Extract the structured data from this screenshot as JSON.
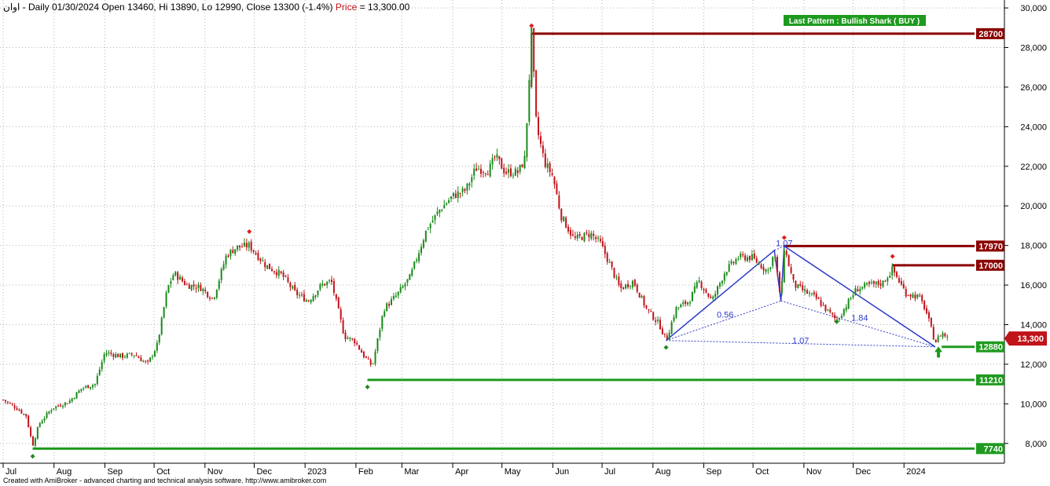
{
  "header": {
    "symbol": "اوان",
    "ohlc_text": " - Daily 01/30/2024 Open 13460, Hi 13890, Lo 12990, Close 13300 (-1.4%)",
    "price_label": " Price",
    "price_value": " = 13,300.00"
  },
  "pattern_label": "Last Pattern : Bullish Shark ( BUY )",
  "footer": "Created with AmiBroker - advanced charting and technical analysis software. http://www.amibroker.com",
  "colors": {
    "up": "#1a8a1a",
    "down": "#c0131a",
    "resistance": "#8b0000",
    "support": "#1e9a1e",
    "pattern": "#2e3cc8"
  },
  "chart_data": {
    "type": "candlestick",
    "ylim": [
      7000,
      30400
    ],
    "x_range_days": [
      0,
      592
    ],
    "y_ticks": [
      {
        "value": 8000,
        "label": "8,000"
      },
      {
        "value": 10000,
        "label": "10,000"
      },
      {
        "value": 12000,
        "label": "12,000"
      },
      {
        "value": 14000,
        "label": "14,000"
      },
      {
        "value": 16000,
        "label": "16,000"
      },
      {
        "value": 18000,
        "label": "18,000"
      },
      {
        "value": 20000,
        "label": "20,000"
      },
      {
        "value": 22000,
        "label": "22,000"
      },
      {
        "value": 24000,
        "label": "24,000"
      },
      {
        "value": 26000,
        "label": "26,000"
      },
      {
        "value": 28000,
        "label": "28,000"
      },
      {
        "value": 30000,
        "label": "30,000"
      }
    ],
    "x_ticks": [
      {
        "day": 0,
        "label": "Jul"
      },
      {
        "day": 31,
        "label": "Aug"
      },
      {
        "day": 62,
        "label": "Sep"
      },
      {
        "day": 92,
        "label": "Oct"
      },
      {
        "day": 123,
        "label": "Nov"
      },
      {
        "day": 153,
        "label": "Dec"
      },
      {
        "day": 184,
        "label": "2023"
      },
      {
        "day": 215,
        "label": "Feb"
      },
      {
        "day": 243,
        "label": "Mar"
      },
      {
        "day": 274,
        "label": "Apr"
      },
      {
        "day": 304,
        "label": "May"
      },
      {
        "day": 335,
        "label": "Jun"
      },
      {
        "day": 365,
        "label": "Jul"
      },
      {
        "day": 396,
        "label": "Aug"
      },
      {
        "day": 427,
        "label": "Sep"
      },
      {
        "day": 457,
        "label": "Oct"
      },
      {
        "day": 488,
        "label": "Nov"
      },
      {
        "day": 518,
        "label": "Dec"
      },
      {
        "day": 549,
        "label": "2024"
      }
    ],
    "anchors": [
      [
        0,
        10200
      ],
      [
        8,
        9800
      ],
      [
        14,
        9400
      ],
      [
        18,
        7900
      ],
      [
        22,
        9000
      ],
      [
        30,
        9800
      ],
      [
        40,
        10100
      ],
      [
        48,
        10800
      ],
      [
        56,
        11000
      ],
      [
        62,
        12600
      ],
      [
        72,
        12400
      ],
      [
        80,
        12500
      ],
      [
        88,
        12000
      ],
      [
        94,
        13000
      ],
      [
        100,
        15800
      ],
      [
        104,
        16600
      ],
      [
        112,
        16000
      ],
      [
        120,
        15900
      ],
      [
        128,
        15300
      ],
      [
        136,
        17500
      ],
      [
        142,
        17900
      ],
      [
        150,
        18000
      ],
      [
        160,
        17000
      ],
      [
        170,
        16500
      ],
      [
        178,
        15600
      ],
      [
        186,
        15200
      ],
      [
        194,
        16000
      ],
      [
        200,
        16200
      ],
      [
        208,
        13400
      ],
      [
        214,
        13200
      ],
      [
        220,
        12400
      ],
      [
        225,
        11900
      ],
      [
        232,
        14800
      ],
      [
        240,
        15500
      ],
      [
        248,
        16400
      ],
      [
        258,
        18800
      ],
      [
        266,
        19800
      ],
      [
        274,
        20500
      ],
      [
        282,
        20800
      ],
      [
        288,
        21900
      ],
      [
        296,
        21800
      ],
      [
        300,
        22500
      ],
      [
        306,
        21700
      ],
      [
        314,
        21700
      ],
      [
        318,
        22400
      ],
      [
        322,
        28700
      ],
      [
        325,
        24000
      ],
      [
        330,
        22200
      ],
      [
        335,
        21500
      ],
      [
        340,
        19500
      ],
      [
        348,
        18300
      ],
      [
        358,
        18600
      ],
      [
        364,
        18100
      ],
      [
        370,
        17000
      ],
      [
        376,
        15800
      ],
      [
        384,
        16200
      ],
      [
        392,
        14800
      ],
      [
        400,
        14000
      ],
      [
        404,
        13200
      ],
      [
        410,
        14800
      ],
      [
        418,
        15200
      ],
      [
        424,
        16200
      ],
      [
        432,
        15200
      ],
      [
        440,
        16700
      ],
      [
        448,
        17400
      ],
      [
        456,
        17400
      ],
      [
        466,
        16700
      ],
      [
        470,
        17600
      ],
      [
        474,
        15200
      ],
      [
        476,
        17900
      ],
      [
        482,
        16000
      ],
      [
        490,
        15600
      ],
      [
        496,
        15300
      ],
      [
        500,
        14900
      ],
      [
        508,
        14200
      ],
      [
        514,
        15000
      ],
      [
        520,
        15800
      ],
      [
        528,
        16000
      ],
      [
        536,
        16100
      ],
      [
        542,
        16800
      ],
      [
        550,
        15600
      ],
      [
        558,
        15400
      ],
      [
        562,
        14800
      ],
      [
        568,
        13100
      ],
      [
        572,
        13600
      ],
      [
        576,
        13300
      ]
    ],
    "last_bar": {
      "date": "01/30/2024",
      "open": 13460,
      "high": 13890,
      "low": 12990,
      "close": 13300,
      "change_pct": -1.4
    },
    "levels": [
      {
        "value": 28700,
        "label": "28700",
        "type": "resistance",
        "start_day": 322
      },
      {
        "value": 17970,
        "label": "17970",
        "type": "resistance",
        "start_day": 476
      },
      {
        "value": 17000,
        "label": "17000",
        "type": "resistance",
        "start_day": 542
      },
      {
        "value": 12880,
        "label": "12880",
        "type": "support",
        "start_day": 572
      },
      {
        "value": 11210,
        "label": "11210",
        "type": "support",
        "start_day": 222
      },
      {
        "value": 7740,
        "label": "7740",
        "type": "support",
        "start_day": 18
      }
    ],
    "current_price": {
      "value": 13300,
      "label": "13,300"
    },
    "pattern": {
      "name": "Bullish Shark",
      "points": [
        [
          404,
          13200
        ],
        [
          470,
          17750
        ],
        [
          474,
          15200
        ],
        [
          476,
          17970
        ],
        [
          568,
          12880
        ]
      ],
      "ratios": [
        {
          "label": "1.07",
          "day": 476,
          "value": 17970
        },
        {
          "label": "0.56",
          "day": 440,
          "value": 14350
        },
        {
          "label": "1.84",
          "day": 522,
          "value": 14200
        },
        {
          "label": "1.07",
          "day": 486,
          "value": 13050
        }
      ]
    },
    "markers": [
      {
        "day": 18,
        "value": 7350,
        "kind": "low"
      },
      {
        "day": 150,
        "value": 18700,
        "kind": "high"
      },
      {
        "day": 222,
        "value": 10850,
        "kind": "low"
      },
      {
        "day": 322,
        "value": 29100,
        "kind": "high"
      },
      {
        "day": 404,
        "value": 12850,
        "kind": "low"
      },
      {
        "day": 476,
        "value": 18400,
        "kind": "high"
      },
      {
        "day": 508,
        "value": 14150,
        "kind": "low"
      },
      {
        "day": 542,
        "value": 17450,
        "kind": "high"
      }
    ],
    "buy_arrow": {
      "day": 570,
      "value": 12500
    }
  }
}
